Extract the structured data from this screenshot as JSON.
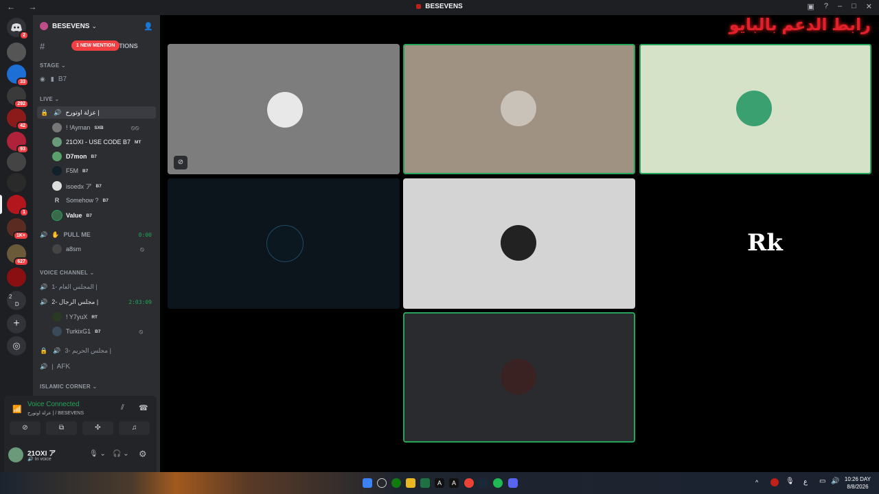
{
  "window": {
    "title": "BESEVENS"
  },
  "server": {
    "name": "BESEVENS"
  },
  "mention_badge": "1 NEW MENTION",
  "channel_partial": "TIONS",
  "categories": {
    "stage": "STAGE",
    "live": "LIVE",
    "voice": "VOICE CHANNEL",
    "islamic": "ISLAMIC CORNER"
  },
  "channels": {
    "b7": "B7",
    "live_channel": "عزلة اوتورح |",
    "pull_me": "PULL ME",
    "pull_me_time": "0:00",
    "vc1": "المجلس العام -1 |",
    "vc2": "مجلس الرجال -2 |",
    "vc2_time": "2:03:09",
    "vc3": "مجلس الحريم -3 |",
    "afk": "AFK"
  },
  "live_members": [
    {
      "name": "! !Ayman",
      "tag": "SXB"
    },
    {
      "name": "21OXI - USE CODE B7",
      "tag": "MT"
    },
    {
      "name": "D7mon",
      "tag": "B7"
    },
    {
      "name": "F5M",
      "tag": "B7"
    },
    {
      "name": "isoedx ア",
      "tag": "B7"
    },
    {
      "name": "Somehow ?",
      "tag": "B7"
    },
    {
      "name": "Value",
      "tag": "B7"
    }
  ],
  "pull_members": [
    {
      "name": "a8sm"
    }
  ],
  "vc2_members": [
    {
      "name": "! Y7yuX",
      "tag": "RT"
    },
    {
      "name": "TurkixG1",
      "tag": "B7"
    }
  ],
  "guild_badges": [
    "2",
    "33",
    "292",
    "42",
    "93",
    "1",
    "1K+",
    "627"
  ],
  "guild_text": {
    "top": "2",
    "bottom": "D"
  },
  "voice": {
    "status": "Voice Connected",
    "where": "عزلة اوتورح | / BESEVENS"
  },
  "user": {
    "name": "21OXI ア",
    "status": "In voice"
  },
  "stage_overlay_text": "رابط الدعم بالبايو",
  "tile_logo": "Rk",
  "clock": {
    "time": "10:26 DAY",
    "date": "8/8/2026"
  },
  "tray_lang": "ع",
  "colors": {
    "accent_green": "#23a55a",
    "badge_red": "#f23f43",
    "sidebar": "#2b2d31",
    "rail": "#1e1f22"
  }
}
